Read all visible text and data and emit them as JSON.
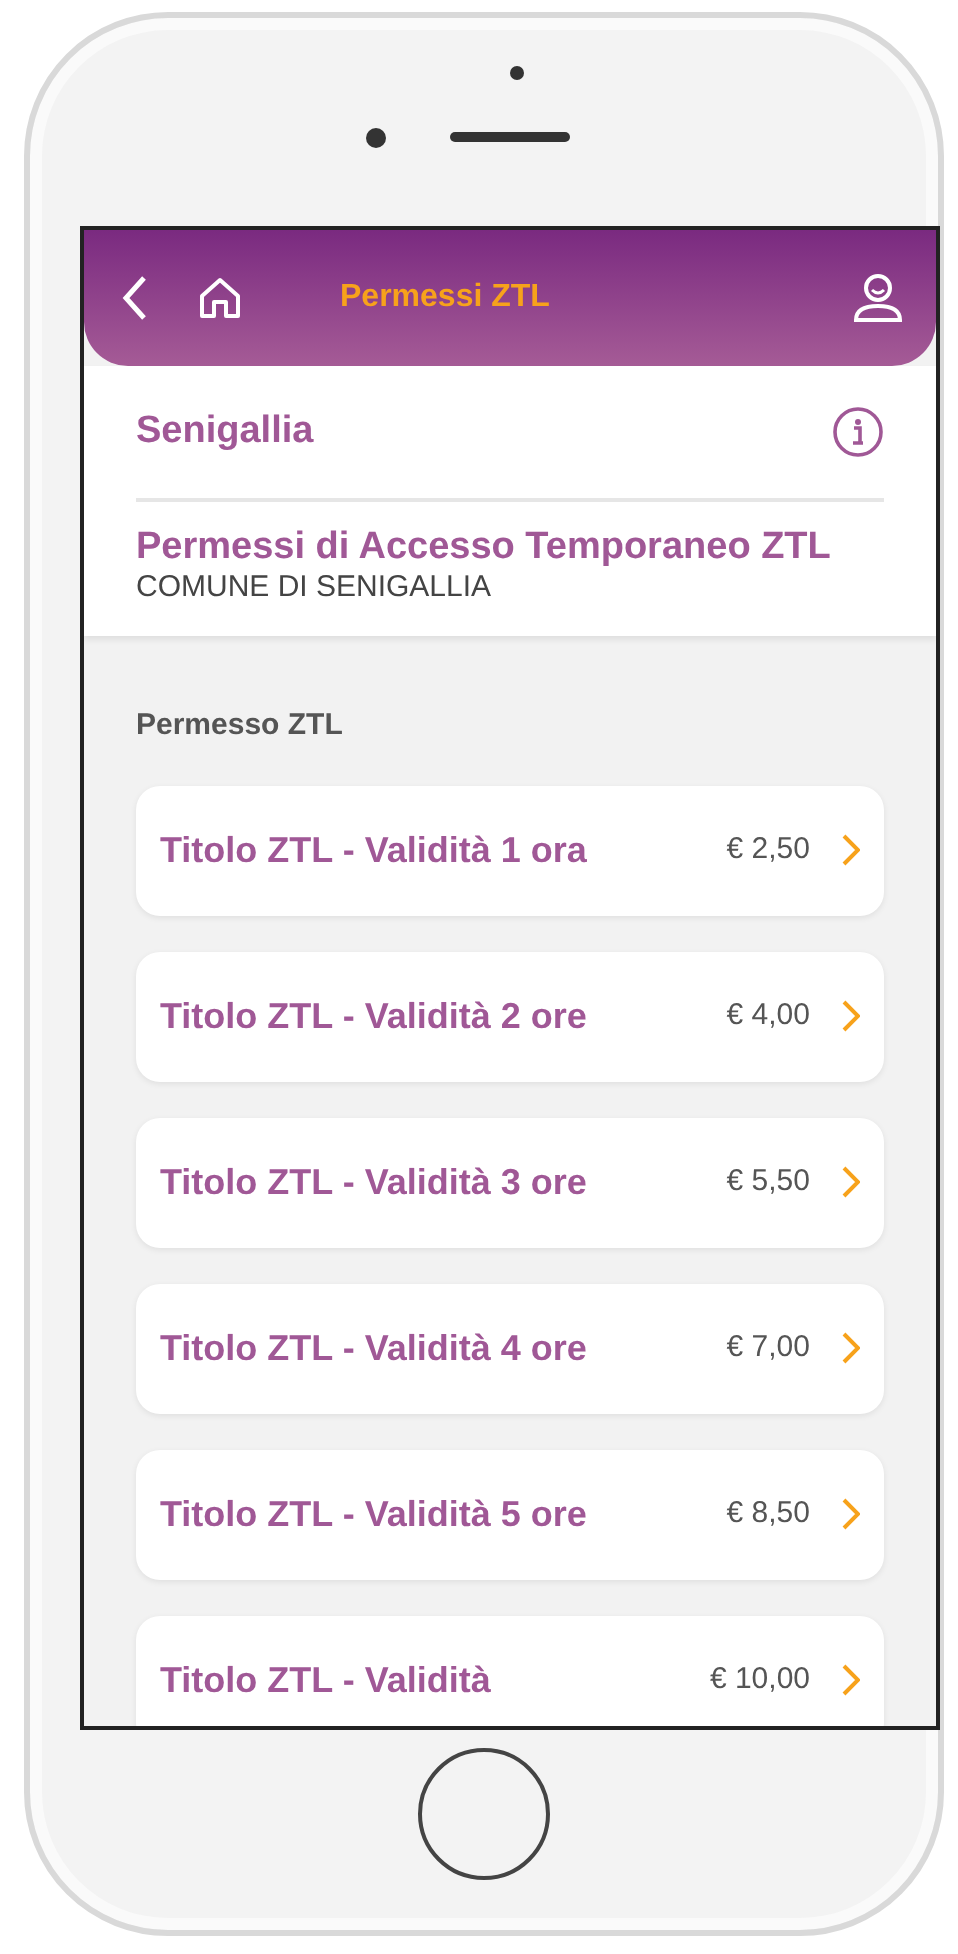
{
  "header": {
    "title": "Permessi ZTL"
  },
  "city": {
    "name": "Senigallia"
  },
  "service": {
    "title": "Permessi di Accesso Temporaneo ZTL",
    "subtitle": "COMUNE DI SENIGALLIA"
  },
  "section": {
    "label": "Permesso ZTL"
  },
  "permits": [
    {
      "title": "Titolo ZTL - Validità 1 ora",
      "price": "€ 2,50"
    },
    {
      "title": "Titolo ZTL - Validità 2 ore",
      "price": "€ 4,00"
    },
    {
      "title": "Titolo ZTL - Validità 3 ore",
      "price": "€ 5,50"
    },
    {
      "title": "Titolo ZTL - Validità 4 ore",
      "price": "€ 7,00"
    },
    {
      "title": "Titolo ZTL - Validità 5 ore",
      "price": "€ 8,50"
    },
    {
      "title": "Titolo ZTL - Validità",
      "price": "€ 10,00"
    }
  ]
}
